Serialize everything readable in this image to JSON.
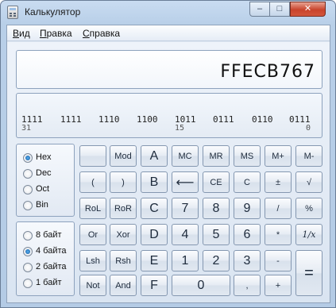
{
  "window": {
    "title": "Калькулятор",
    "controls": {
      "minimize": "–",
      "maximize": "□",
      "close": "✕"
    }
  },
  "menu": {
    "items": [
      "Вид",
      "Правка",
      "Справка"
    ]
  },
  "display": {
    "value": "FFECB767"
  },
  "bits": {
    "groups": [
      "1111",
      "1111",
      "1110",
      "1100",
      "1011",
      "0111",
      "0110",
      "0111"
    ],
    "indices": [
      "31",
      "15",
      "0"
    ]
  },
  "base": {
    "options": [
      "Hex",
      "Dec",
      "Oct",
      "Bin"
    ],
    "selected": "Hex"
  },
  "word_size": {
    "options": [
      "8 байт",
      "4 байта",
      "2 байта",
      "1 байт"
    ],
    "selected": "4 байта"
  },
  "keys": {
    "blank": "",
    "mod": "Mod",
    "a": "A",
    "mc": "MC",
    "mr": "MR",
    "ms": "MS",
    "mplus": "M+",
    "mminus": "M-",
    "lparen": "(",
    "rparen": ")",
    "b": "B",
    "back": "⟵",
    "ce": "CE",
    "c": "C",
    "plusminus": "±",
    "sqrt": "√",
    "rol": "RoL",
    "ror": "RoR",
    "cc": "C",
    "seven": "7",
    "eight": "8",
    "nine": "9",
    "div": "/",
    "percent": "%",
    "or": "Or",
    "xor": "Xor",
    "d": "D",
    "four": "4",
    "five": "5",
    "six": "6",
    "mul": "*",
    "recip": "1/x",
    "lsh": "Lsh",
    "rsh": "Rsh",
    "e": "E",
    "one": "1",
    "two": "2",
    "three": "3",
    "minus": "-",
    "equals": "=",
    "not": "Not",
    "and": "And",
    "f": "F",
    "zero": "0",
    "dot": ",",
    "plus": "+"
  }
}
